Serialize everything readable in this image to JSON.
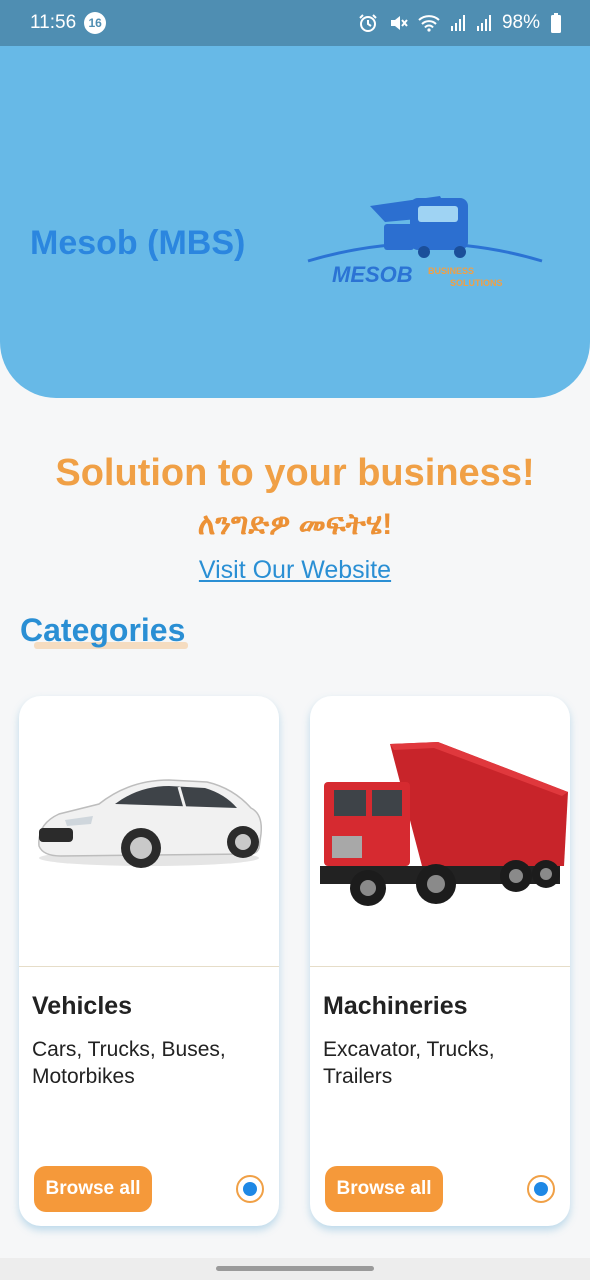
{
  "status_bar": {
    "time": "11:56",
    "notification_count": "16",
    "battery": "98%",
    "icons": [
      "alarm-icon",
      "mute-icon",
      "wifi-icon",
      "signal-icon",
      "signal-icon",
      "battery-icon"
    ]
  },
  "header": {
    "app_name": "Mesob (MBS)",
    "logo_text": "MESOB",
    "logo_subtext_1": "BUSINESS",
    "logo_subtext_2": "SOLUTIONS"
  },
  "tagline": {
    "english": "Solution to your business!",
    "amharic": "ለንግድዎ መፍትሄ!"
  },
  "visit_link": "Visit Our Website",
  "categories": {
    "title": "Categories",
    "items": [
      {
        "title": "Vehicles",
        "description": "Cars, Trucks, Buses, Motorbikes",
        "button": "Browse all",
        "image_icon": "car-image"
      },
      {
        "title": "Machineries",
        "description": "Excavator, Trucks, Trailers",
        "button": "Browse all",
        "image_icon": "dump-truck-image"
      }
    ]
  },
  "colors": {
    "header_bg": "#67b9e7",
    "status_bg": "#4f8eb2",
    "accent_orange": "#f0a046",
    "link_blue": "#2a8fd4",
    "button_orange": "#f5993a"
  }
}
